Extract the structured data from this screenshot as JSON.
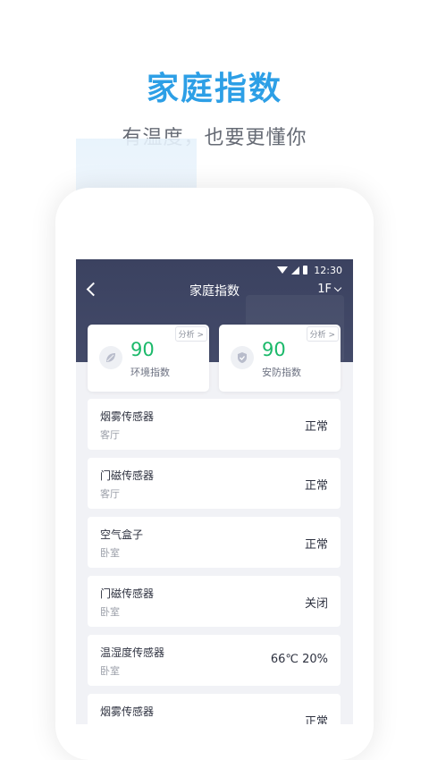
{
  "promo": {
    "title": "家庭指数",
    "subtitle": "有温度，也要更懂你"
  },
  "status_bar": {
    "time": "12:30"
  },
  "header": {
    "title": "家庭指数",
    "floor": "1F"
  },
  "cards": [
    {
      "value": "90",
      "label": "环境指数",
      "tag": "分析 >",
      "icon": "leaf-icon"
    },
    {
      "value": "90",
      "label": "安防指数",
      "tag": "分析 >",
      "icon": "shield-check-icon"
    }
  ],
  "devices": [
    {
      "name": "烟雾传感器",
      "room": "客厅",
      "status": "正常"
    },
    {
      "name": "门磁传感器",
      "room": "客厅",
      "status": "正常"
    },
    {
      "name": "空气盒子",
      "room": "卧室",
      "status": "正常"
    },
    {
      "name": "门磁传感器",
      "room": "卧室",
      "status": "关闭"
    },
    {
      "name": "温湿度传感器",
      "room": "卧室",
      "status": "66℃ 20%"
    },
    {
      "name": "烟雾传感器",
      "room": "",
      "status": "正常"
    }
  ],
  "colors": {
    "accent": "#2d9fe6",
    "header_bg": "#3b4260",
    "value_green": "#1bb96a"
  }
}
